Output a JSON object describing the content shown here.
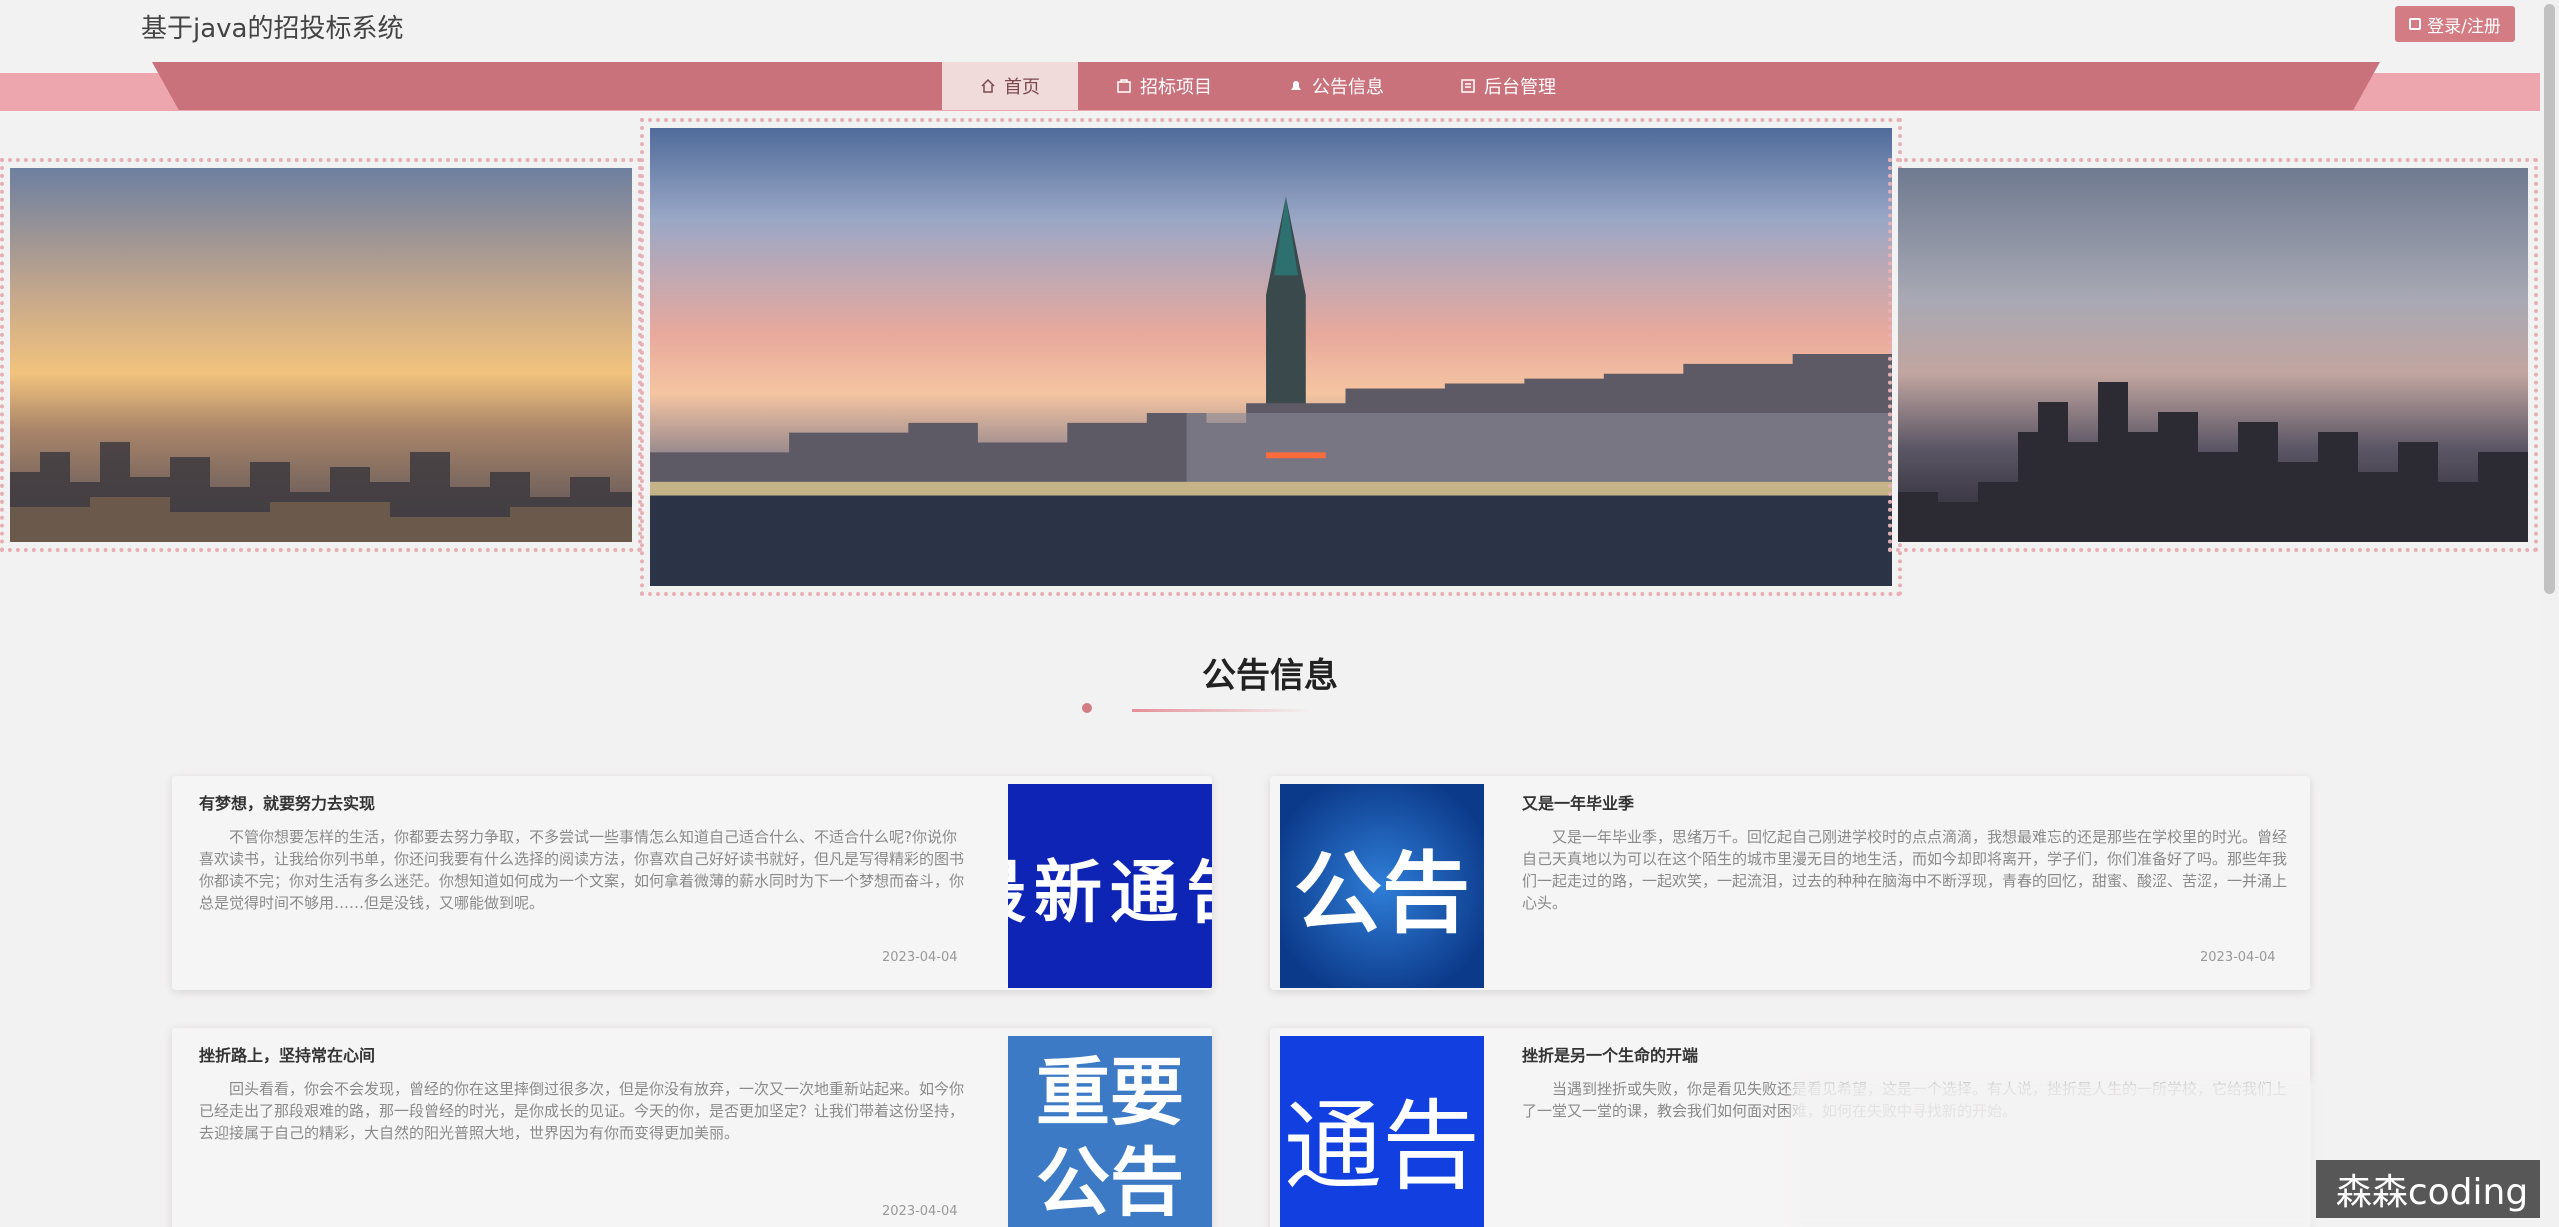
{
  "header": {
    "title": "基于java的招投标系统",
    "login_label": "登录/注册"
  },
  "nav": {
    "items": [
      {
        "label": "首页",
        "icon": "home-icon",
        "active": true
      },
      {
        "label": "招标项目",
        "icon": "bid-icon",
        "active": false
      },
      {
        "label": "公告信息",
        "icon": "notice-icon",
        "active": false
      },
      {
        "label": "后台管理",
        "icon": "admin-icon",
        "active": false
      }
    ]
  },
  "section": {
    "title": "公告信息"
  },
  "news": [
    {
      "title": "有梦想，就要努力去实现",
      "body": "不管你想要怎样的生活，你都要去努力争取，不多尝试一些事情怎么知道自己适合什么、不适合什么呢?你说你喜欢读书，让我给你列书单，你还问我要有什么选择的阅读方法，你喜欢自己好好读书就好，但凡是写得精彩的图书你都读不完；你对生活有多么迷茫。你想知道如何成为一个文案，如何拿着微薄的薪水同时为下一个梦想而奋斗，你总是觉得时间不够用……但是没钱，又哪能做到呢。",
      "date": "2023-04-04",
      "thumb": "最新通告"
    },
    {
      "title": "又是一年毕业季",
      "body": "又是一年毕业季，思绪万千。回忆起自己刚进学校时的点点滴滴，我想最难忘的还是那些在学校里的时光。曾经自己天真地以为可以在这个陌生的城市里漫无目的地生活，而如今却即将离开，学子们，你们准备好了吗。那些年我们一起走过的路，一起欢笑，一起流泪，过去的种种在脑海中不断浮现，青春的回忆，甜蜜、酸涩、苦涩，一并涌上心头。",
      "date": "2023-04-04",
      "thumb": "公告"
    },
    {
      "title": "挫折路上，坚持常在心间",
      "body": "回头看看，你会不会发现，曾经的你在这里摔倒过很多次，但是你没有放弃，一次又一次地重新站起来。如今你已经走出了那段艰难的路，那一段曾经的时光，是你成长的见证。今天的你，是否更加坚定？让我们带着这份坚持，去迎接属于自己的精彩，大自然的阳光普照大地，世界因为有你而变得更加美丽。",
      "date": "2023-04-04",
      "thumb": "重要公告"
    },
    {
      "title": "挫折是另一个生命的开端",
      "body": "当遇到挫折或失败，你是看见失败还是看见希望，这是一个选择。有人说，挫折是人生的一所学校，它给我们上了一堂又一堂的课，教会我们如何面对困难，如何在失败中寻找新的开始。",
      "date": "",
      "thumb": "通告"
    }
  ],
  "watermark": "森森coding"
}
